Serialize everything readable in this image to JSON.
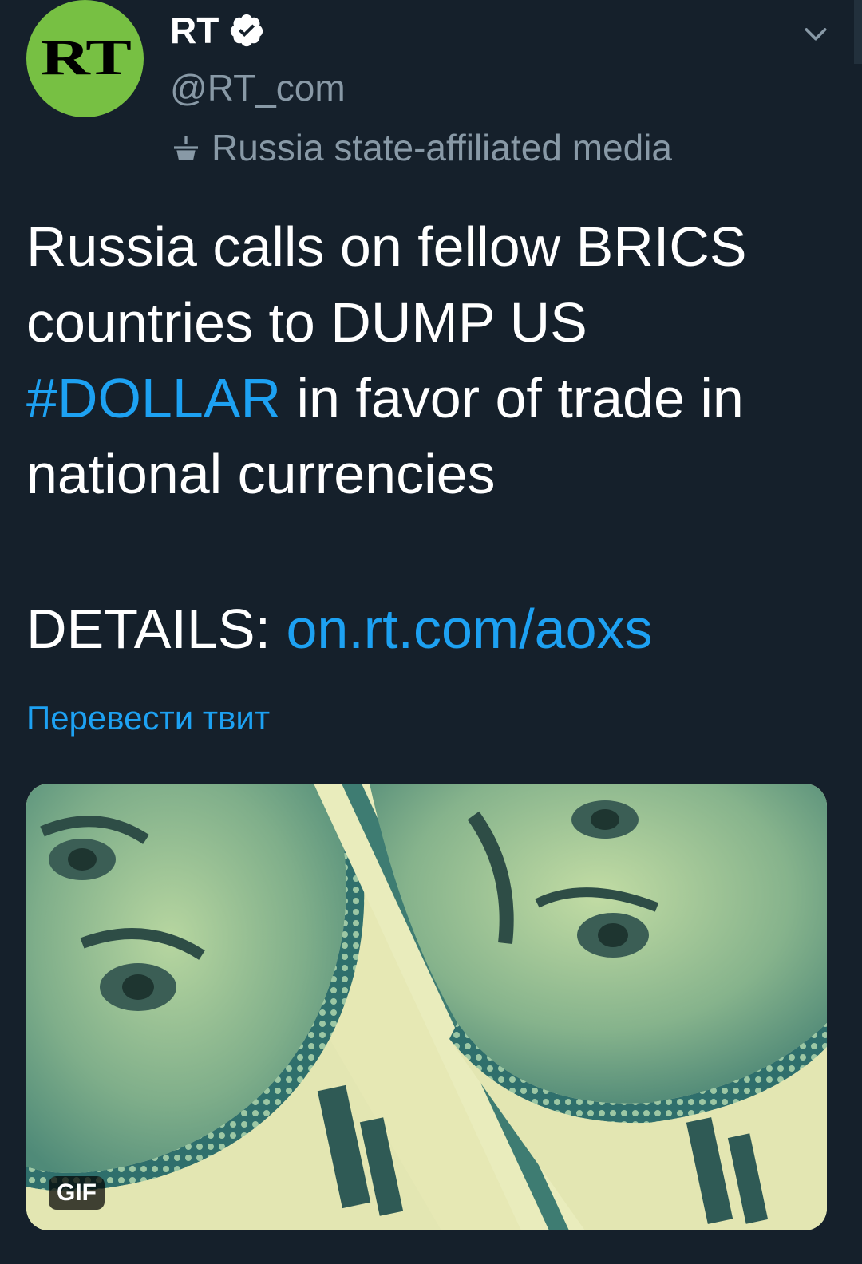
{
  "account": {
    "display_name": "RT",
    "handle": "@RT_com",
    "label": "Russia state-affiliated media",
    "avatar_text": "RT",
    "avatar_color": "#77c043",
    "verified": true
  },
  "tweet": {
    "text_part1": "Russia calls on fellow BRICS\ncountries to DUMP US\n",
    "hashtag": "#DOLLAR",
    "text_part2": " in favor of trade in\nnational currencies",
    "details_prefix": "DETAILS: ",
    "link": "on.rt.com/aoxs",
    "translate_label": "Перевести твит"
  },
  "media": {
    "badge": "GIF",
    "description_icon": "dollar-banknote-image"
  },
  "colors": {
    "background": "#15202b",
    "text": "#ffffff",
    "secondary": "#8899a6",
    "accent": "#1da1f2"
  }
}
